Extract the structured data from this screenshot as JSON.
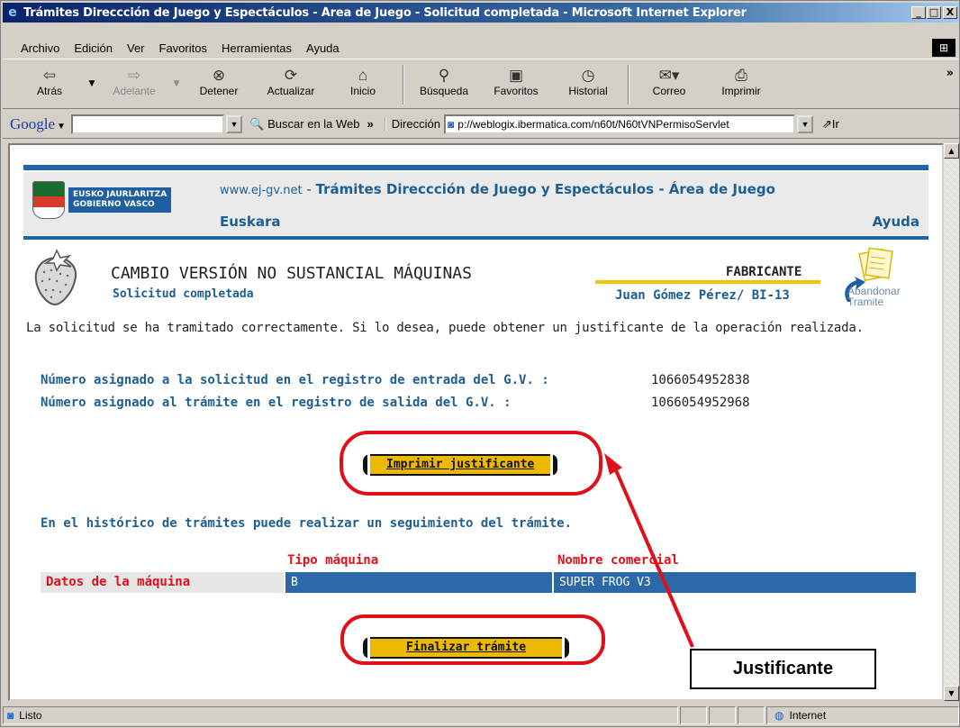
{
  "window": {
    "title": "Trámites Direccción de Juego y Espectáculos - Área de Juego - Solicitud completada - Microsoft Internet Explorer",
    "controls": [
      "_",
      "□",
      "X"
    ]
  },
  "menu": [
    "Archivo",
    "Edición",
    "Ver",
    "Favoritos",
    "Herramientas",
    "Ayuda"
  ],
  "toolbar": {
    "back": "Atrás",
    "forward": "Adelante",
    "stop": "Detener",
    "refresh": "Actualizar",
    "home": "Inicio",
    "search": "Búsqueda",
    "favorites": "Favoritos",
    "history": "Historial",
    "mail": "Correo",
    "print": "Imprimir"
  },
  "googlebar": {
    "logo": "Google",
    "search_value": "",
    "search_web": "Buscar en la Web"
  },
  "address": {
    "label": "Dirección",
    "url": "p://weblogix.ibermatica.com/n60t/N60tVNPermisoServlet",
    "go": "Ir"
  },
  "header": {
    "logo_line1": "EUSKO JAURLARITZA",
    "logo_line2": "GOBIERNO VASCO",
    "site": "www.ej-gv.net",
    "separator": " - ",
    "title": "Trámites Direccción de Juego y Espectáculos - Área de Juego",
    "euskara": "Euskara",
    "ayuda": "Ayuda"
  },
  "form": {
    "title": "CAMBIO VERSIÓN NO SUSTANCIAL MÁQUINAS",
    "subtitle": "Solicitud completada",
    "role": "FABRICANTE",
    "user": "Juan Gómez Pérez/ BI-13",
    "abandon_line1": "Abandonar",
    "abandon_line2": "Tramite",
    "message": "La solicitud se ha tramitado correctamente. Si lo desea, puede obtener un justificante de la operación realizada.",
    "entry_label": "Número asignado a la solicitud en el registro de entrada del G.V. :",
    "entry_value": "1066054952838",
    "exit_label": "Número asignado al trámite en el registro de salida del G.V. :",
    "exit_value": "1066054952968",
    "print_button": "Imprimir justificante",
    "history_text": "En el histórico de trámites puede realizar un seguimiento del trámite.",
    "table": {
      "col_type": "Tipo máquina",
      "col_name": "Nombre comercial",
      "row_label": "Datos de la máquina",
      "type_value": "B",
      "name_value": "SUPER FROG V3"
    },
    "finish_button": "Finalizar trámite"
  },
  "annotation": {
    "callout": "Justificante",
    "color": "#e0101a"
  },
  "status": {
    "text": "Listo",
    "zone": "Internet"
  }
}
